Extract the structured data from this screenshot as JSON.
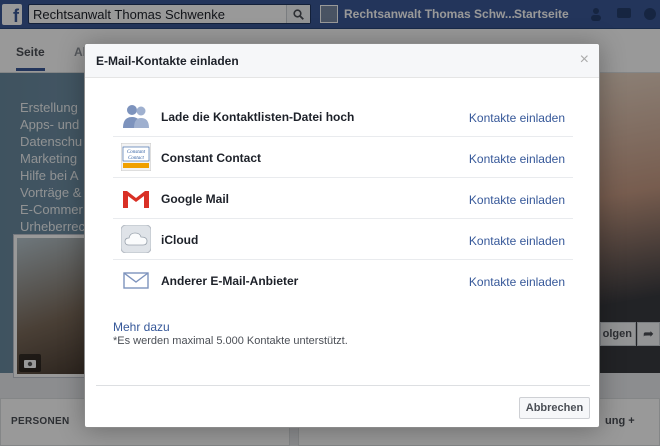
{
  "topbar": {
    "search_value": "Rechtsanwalt Thomas Schwenke",
    "profile_name": "Rechtsanwalt Thomas Schw...",
    "home_label": "Startseite"
  },
  "tabs": {
    "active": "Seite",
    "next": "Al"
  },
  "page": {
    "bio_lines": [
      "Erstellung",
      "Apps- und",
      "Datenschu",
      "Marketing",
      "Hilfe bei A",
      "Vorträge &",
      "E-Commer",
      "Urheberrec"
    ],
    "follow_label": "olgen",
    "personen_label": "PERSONEN",
    "lower_right_label": "ung +"
  },
  "dialog": {
    "title": "E-Mail-Kontakte einladen",
    "close_glyph": "×",
    "providers": [
      {
        "name": "Lade die Kontaktlisten-Datei hoch",
        "icon": "upload-contacts-icon",
        "link": "Kontakte einladen"
      },
      {
        "name": "Constant Contact",
        "icon": "constant-contact-icon",
        "link": "Kontakte einladen"
      },
      {
        "name": "Google Mail",
        "icon": "gmail-icon",
        "link": "Kontakte einladen"
      },
      {
        "name": "iCloud",
        "icon": "icloud-icon",
        "link": "Kontakte einladen"
      },
      {
        "name": "Anderer E-Mail-Anbieter",
        "icon": "envelope-icon",
        "link": "Kontakte einladen"
      }
    ],
    "more_link": "Mehr dazu",
    "note": "*Es werden maximal 5.000 Kontakte unterstützt.",
    "cancel_label": "Abbrechen",
    "accent_color": "#365899",
    "brand_color": "#3b5998"
  }
}
